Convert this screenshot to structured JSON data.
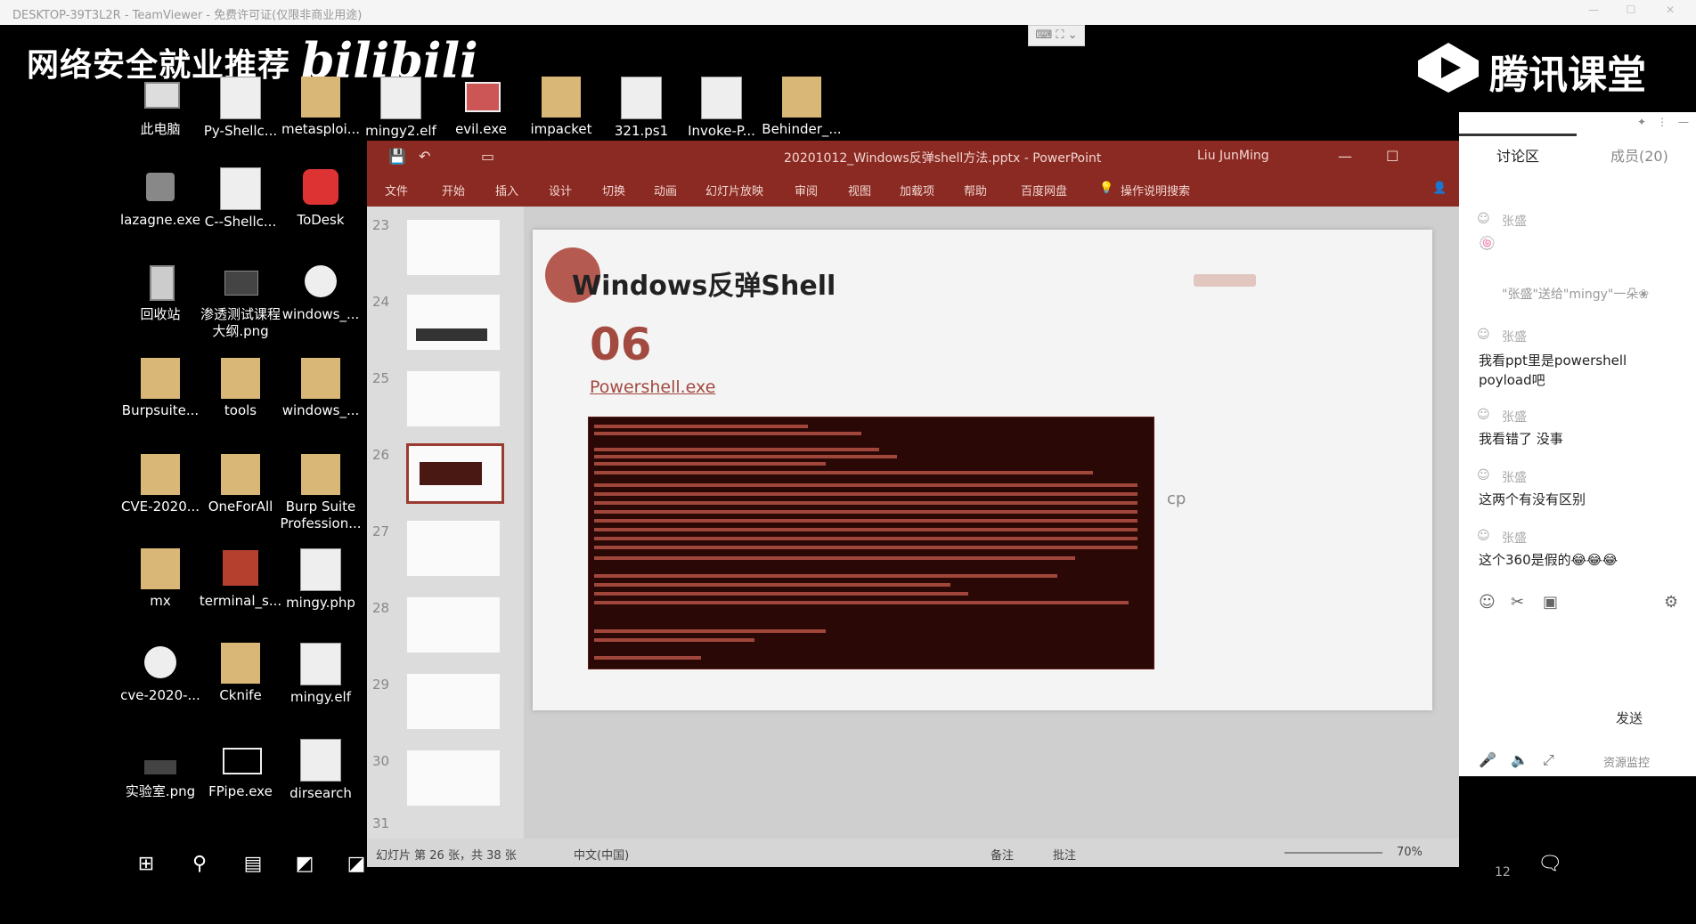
{
  "teamviewer": {
    "title": "DESKTOP-39T3L2R - TeamViewer - 免费许可证(仅限非商业用途)",
    "screen_control_label": "⌨ ⛶ ⌄"
  },
  "overlays": {
    "headline": "网络安全就业推荐",
    "bilibili": "bilibili",
    "tencent_class": "腾讯课堂"
  },
  "desktop_icons": [
    {
      "label": "此电脑"
    },
    {
      "label": "Py-Shellc..."
    },
    {
      "label": "metasploi..."
    },
    {
      "label": "mingy2.elf"
    },
    {
      "label": "evil.exe"
    },
    {
      "label": "impacket"
    },
    {
      "label": "321.ps1"
    },
    {
      "label": "Invoke-P..."
    },
    {
      "label": "Behinder_..."
    },
    {
      "label": "lazagne.exe"
    },
    {
      "label": "C--Shellc..."
    },
    {
      "label": "ToDesk"
    },
    {
      "label": "回收站"
    },
    {
      "label": "渗透测试课程大纲.png"
    },
    {
      "label": "windows_..."
    },
    {
      "label": "Burpsuite..."
    },
    {
      "label": "tools"
    },
    {
      "label": "windows_..."
    },
    {
      "label": "CVE-2020..."
    },
    {
      "label": "OneForAll"
    },
    {
      "label": "Burp Suite Profession..."
    },
    {
      "label": "mx"
    },
    {
      "label": "terminal_s..."
    },
    {
      "label": "mingy.php"
    },
    {
      "label": "cve-2020-..."
    },
    {
      "label": "Cknife"
    },
    {
      "label": "mingy.elf"
    },
    {
      "label": "实验室.png"
    },
    {
      "label": "FPipe.exe"
    },
    {
      "label": "dirsearch"
    }
  ],
  "powerpoint": {
    "file_title": "20201012_Windows反弹shell方法.pptx - PowerPoint",
    "user": "Liu JunMing",
    "ribbon_tabs": [
      "文件",
      "开始",
      "插入",
      "设计",
      "切换",
      "动画",
      "幻灯片放映",
      "审阅",
      "视图",
      "加载项",
      "帮助",
      "百度网盘",
      "操作说明搜索"
    ],
    "slide_numbers": [
      "23",
      "24",
      "25",
      "26",
      "27",
      "28",
      "29",
      "30",
      "31"
    ],
    "slide": {
      "title": "Windows反弹Shell",
      "number": "06",
      "subtitle": "Powershell.exe",
      "side_text": "cp"
    },
    "status": {
      "slide_info": "幻灯片 第 26 张，共 38 张",
      "language": "中文(中国)",
      "notes": "备注",
      "comments": "批注",
      "zoom": "70%"
    }
  },
  "chat": {
    "tabs": {
      "discussion": "讨论区",
      "members": "成员(20)"
    },
    "messages": [
      {
        "name": "张盛",
        "text": "🍥"
      },
      {
        "system": "\"张盛\"送给\"mingy\"一朵❀"
      },
      {
        "name": "张盛",
        "text": "我看ppt里是powershell poyload吧"
      },
      {
        "name": "张盛",
        "text": "我看错了 没事"
      },
      {
        "name": "张盛",
        "text": "这两个有没有区别"
      },
      {
        "name": "张盛",
        "text": "这个360是假的😂😂😂"
      }
    ],
    "send_label": "发送",
    "resource_monitor": "资源监控"
  },
  "taskbar": {
    "time_partial": "12"
  }
}
